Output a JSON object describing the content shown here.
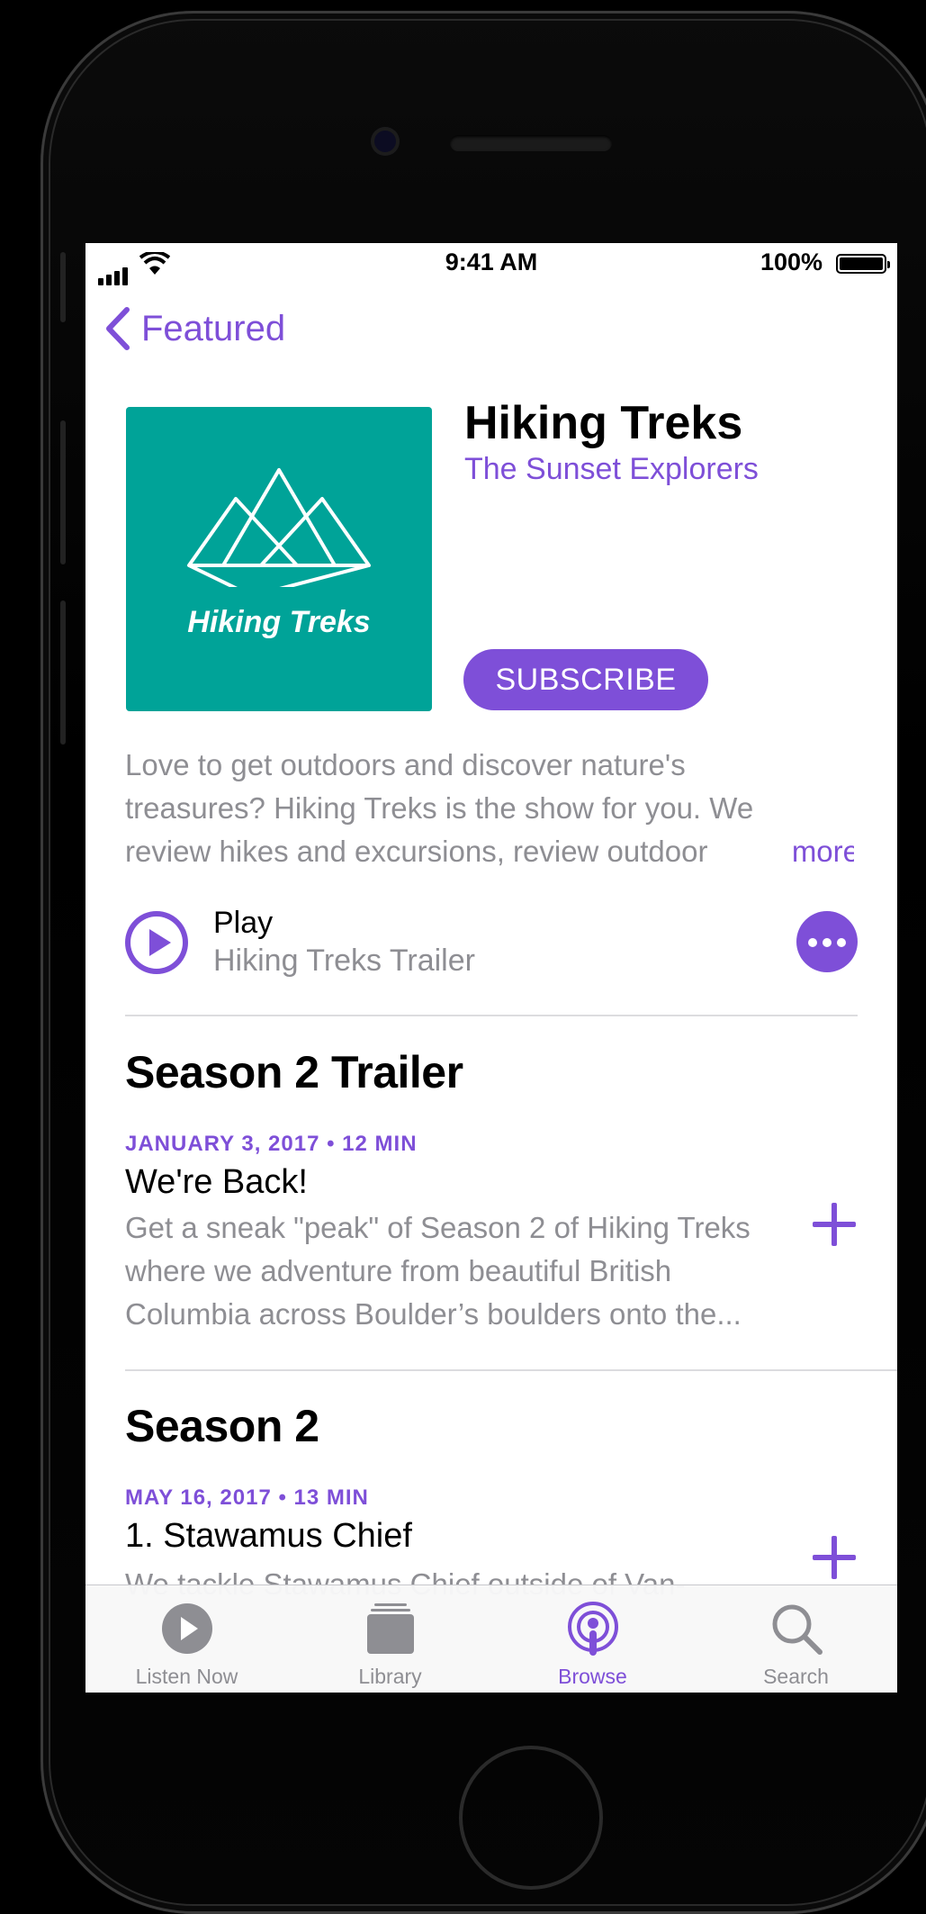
{
  "status_bar": {
    "time": "9:41 AM",
    "battery": "100%"
  },
  "nav": {
    "back_label": "Featured"
  },
  "podcast": {
    "artwork_title": "Hiking Treks",
    "title": "Hiking Treks",
    "author": "The Sunset Explorers",
    "subscribe_label": "SUBSCRIBE",
    "description_lines": [
      "Love to get outdoors and discover nature's",
      "treasures? Hiking Treks is the show for you. We",
      "review hikes and excursions, review outdoor"
    ],
    "more_label": "more"
  },
  "play": {
    "label": "Play",
    "episode": "Hiking Treks Trailer"
  },
  "sections": [
    {
      "title": "Season 2 Trailer",
      "episode": {
        "meta": "JANUARY 3, 2017 • 12 MIN",
        "title": "We're Back!",
        "description_lines": [
          "Get a sneak \"peak\" of Season 2 of Hiking Treks",
          "where we adventure from beautiful British",
          "Columbia across Boulder’s boulders onto the..."
        ]
      }
    },
    {
      "title": "Season 2",
      "episode": {
        "meta": "MAY 16, 2017 • 13 MIN",
        "title": "1. Stawamus Chief",
        "description_lines": [
          "We tackle Stawamus Chief outside of Van-"
        ]
      }
    }
  ],
  "tabbar": {
    "tabs": [
      {
        "label": "Listen Now",
        "icon": "play-circle-icon",
        "active": false
      },
      {
        "label": "Library",
        "icon": "library-stack-icon",
        "active": false
      },
      {
        "label": "Browse",
        "icon": "podcast-icon",
        "active": true
      },
      {
        "label": "Search",
        "icon": "search-icon",
        "active": false
      }
    ]
  },
  "colors": {
    "accent": "#7E4FD8",
    "artwork_bg": "#00A398",
    "secondary_text": "#8e8e93"
  }
}
